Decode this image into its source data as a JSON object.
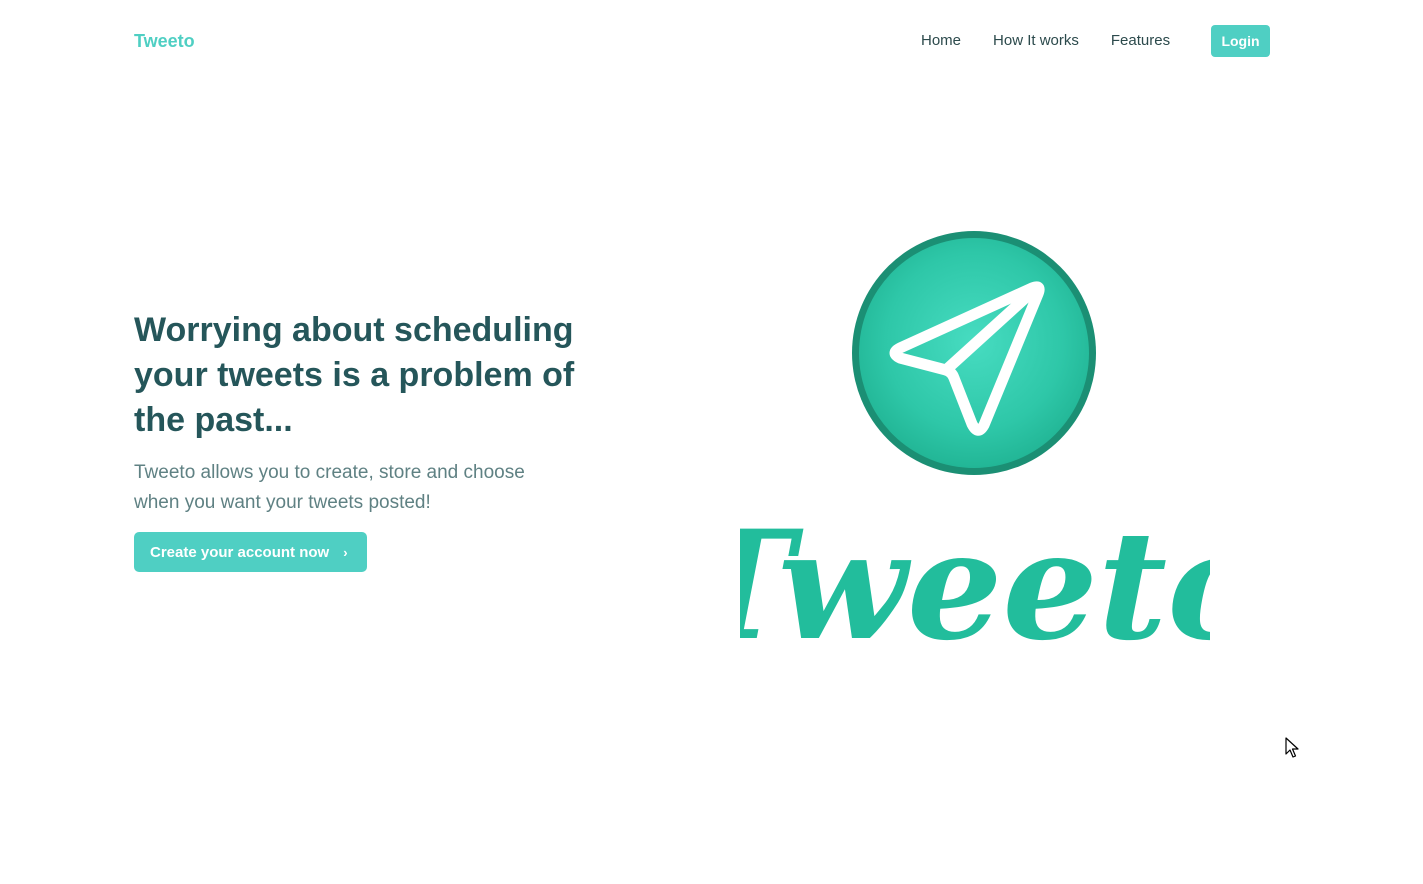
{
  "nav": {
    "brand": "Tweeto",
    "links": [
      {
        "label": "Home"
      },
      {
        "label": "How It works"
      },
      {
        "label": "Features"
      }
    ],
    "login_label": "Login"
  },
  "hero": {
    "title": "Worrying about scheduling your tweets is a problem of the past...",
    "subtitle": "Tweeto allows you to create, store and choose when you want your tweets posted!",
    "cta_label": "Create your account now",
    "cta_icon": "chevron-right-icon"
  },
  "logo": {
    "wordmark": "Tweeto",
    "icon": "paper-plane-icon"
  },
  "colors": {
    "accent": "#4fcfc3",
    "heading": "#25565a",
    "body_text": "#5f8183",
    "nav_text": "#2c4a4c",
    "logo_green": "#22bd9c",
    "logo_circle_dark": "#1b8f74"
  }
}
